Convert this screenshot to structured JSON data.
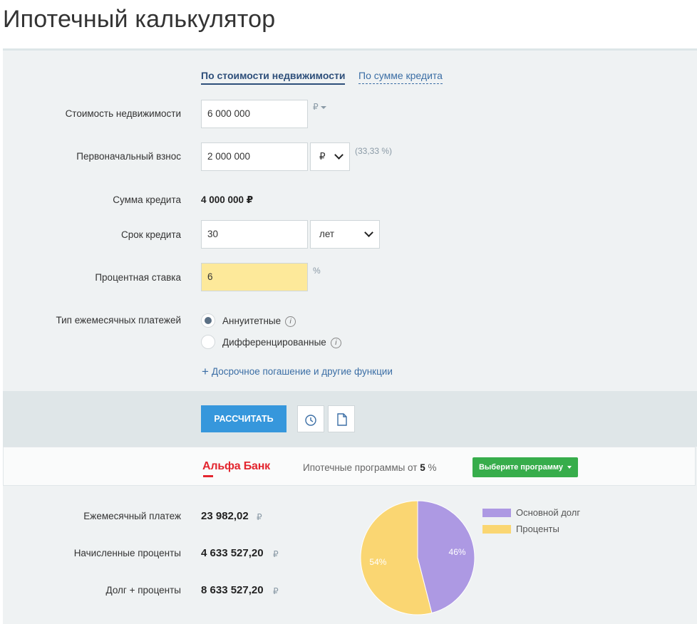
{
  "page": {
    "title": "Ипотечный калькулятор"
  },
  "mode_tabs": {
    "by_property": "По стоимости недвижимости",
    "by_credit": "По сумме кредита"
  },
  "form": {
    "property_cost": {
      "label": "Стоимость недвижимости",
      "value": "6 000 000",
      "unit": "₽"
    },
    "down_payment": {
      "label": "Первоначальный взнос",
      "value": "2 000 000",
      "currency": "₽",
      "percent": "(33,33 %)"
    },
    "credit_sum": {
      "label": "Сумма кредита",
      "value": "4 000 000 ₽"
    },
    "term": {
      "label": "Срок кредита",
      "value": "30",
      "unit": "лет"
    },
    "rate": {
      "label": "Процентная ставка",
      "value": "6",
      "unit": "%"
    },
    "payment_type": {
      "label": "Тип ежемесячных платежей",
      "options": [
        "Аннуитетные",
        "Дифференцированные"
      ],
      "selected": "Аннуитетные"
    },
    "extra_link": "Досрочное погашение и другие функции"
  },
  "actions": {
    "calculate": "РАССЧИТАТЬ"
  },
  "bank": {
    "name": "Альфа Банк",
    "text_prefix": "Ипотечные программы от",
    "rate": "5",
    "rate_suffix": "%",
    "button": "Выберите программу"
  },
  "results": {
    "monthly": {
      "label": "Ежемесячный платеж",
      "value": "23 982,02",
      "currency": "₽"
    },
    "interest": {
      "label": "Начисленные проценты",
      "value": "4 633 527,20",
      "currency": "₽"
    },
    "total": {
      "label": "Долг + проценты",
      "value": "8 633 527,20",
      "currency": "₽"
    }
  },
  "chart_data": {
    "type": "pie",
    "series": [
      {
        "name": "Основной долг",
        "percent": 46,
        "label": "46%",
        "color": "#ad99e3"
      },
      {
        "name": "Проценты",
        "percent": 54,
        "label": "54%",
        "color": "#fad672"
      }
    ]
  }
}
